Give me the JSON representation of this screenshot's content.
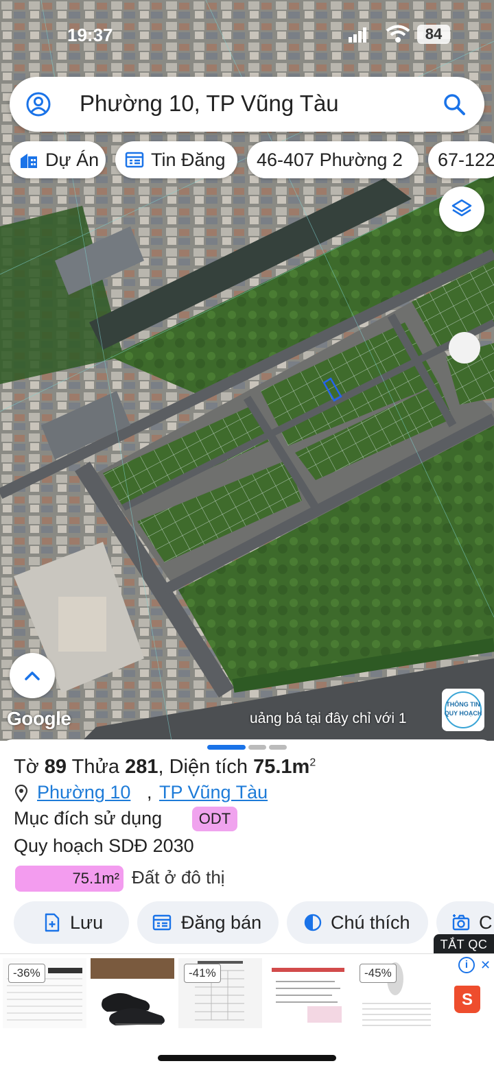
{
  "status_bar": {
    "time": "19:37",
    "battery": "84"
  },
  "search": {
    "query": "Phường 10, TP Vũng Tàu"
  },
  "chips": [
    {
      "label": "Dự Án",
      "icon": "building-icon"
    },
    {
      "label": "Tin Đăng",
      "icon": "listing-icon"
    },
    {
      "label": "46-407 Phường 2"
    },
    {
      "label": "67-122"
    }
  ],
  "map": {
    "attribution": "Google",
    "promo_text": "uảng bá tại đây chỉ với 1",
    "logo": {
      "line1": "THÔNG TIN",
      "line2": "QUY HOẠCH"
    }
  },
  "parcel": {
    "sheet_label": "Tờ",
    "sheet_no": "89",
    "lot_label": "Thửa",
    "lot_no": "281",
    "area_label": ", Diện tích",
    "area_value": "75.1m",
    "area_unit_sup": "2",
    "location_ward": "Phường 10",
    "location_city": "TP Vũng Tàu",
    "purpose_label": "Mục đích sử dụng",
    "purpose_code": "ODT",
    "plan_label": "Quy hoạch SDĐ 2030",
    "plan_area": "75.1m²",
    "plan_use": "Đất ở đô thị",
    "plan_fraction": 1.0
  },
  "actions": [
    {
      "label": "Lưu",
      "icon": "save-icon"
    },
    {
      "label": "Đăng bán",
      "icon": "post-icon"
    },
    {
      "label": "Chú thích",
      "icon": "legend-icon"
    },
    {
      "label": "C",
      "icon": "camera-icon"
    }
  ],
  "ad": {
    "close_label": "TẮT QC",
    "discounts": [
      "-36%",
      "-41%",
      "-45%"
    ],
    "shopee": "S"
  },
  "colors": {
    "accent": "#1a73e8",
    "highlight_pink": "#f39cef",
    "link": "#1d7bd8"
  }
}
